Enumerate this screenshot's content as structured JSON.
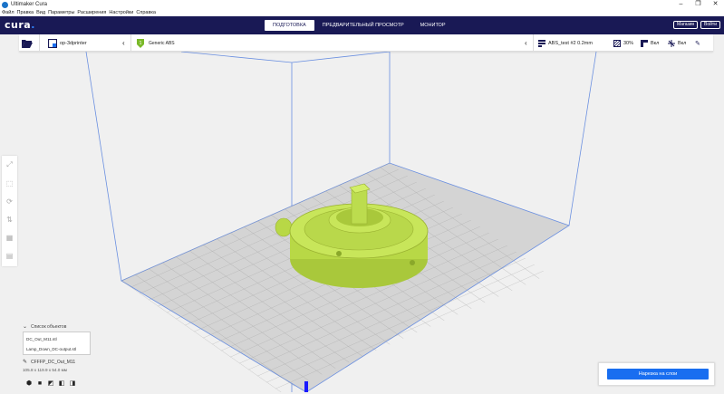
{
  "window": {
    "title": "Ultimaker Cura",
    "controls": [
      "–",
      "❐",
      "✕"
    ]
  },
  "menu": [
    "Файл",
    "Правка",
    "Вид",
    "Параметры",
    "Расширения",
    "Настройки",
    "Справка"
  ],
  "header": {
    "logo": "cura",
    "logo_dot": ".",
    "tabs": [
      "ПОДГОТОВКА",
      "ПРЕДВАРИТЕЛЬНЫЙ ПРОСМОТР",
      "МОНИТОР"
    ],
    "active_tab": 0,
    "store_label": "Магазин",
    "login_label": "Войти"
  },
  "toolbar": {
    "printer": "op-3dprinter",
    "material": "Generic ABS",
    "profile": "ABS_test #2 0.2mm",
    "infill": "30%",
    "support": "Вкл",
    "adhesion": "Вкл"
  },
  "objects": {
    "header": "Список объектов",
    "items": [
      "DC_Out_M11.stl",
      "Lamp_Down_DC-output.stl"
    ],
    "current_name": "CFFFP_DC_Out_M11",
    "dimensions": "105.8 x 119.9 x 54.0 мм"
  },
  "slice": {
    "button_label": "Нарезка на слои"
  },
  "colors": {
    "header_bg": "#191955",
    "accent": "#196ef0",
    "model": "#c2e34f",
    "build_line": "#6a8fe0"
  }
}
